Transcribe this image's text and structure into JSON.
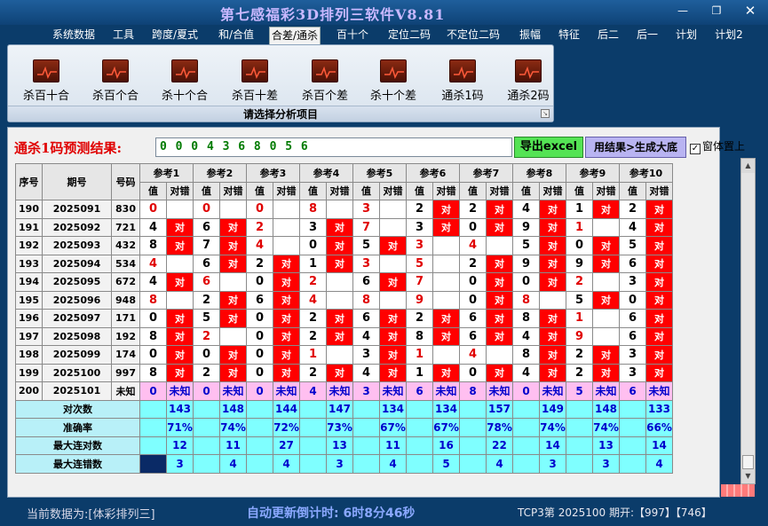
{
  "app": {
    "title": "第七感福彩3D排列三软件V8.81"
  },
  "menu": [
    "系统数据",
    "工具",
    "跨度/夏式",
    "和/合值",
    "合差/通杀",
    "百十个",
    "定位二码",
    "不定位二码",
    "振幅",
    "特征",
    "后二",
    "后一",
    "计划",
    "计划2"
  ],
  "menu_active": "合差/通杀",
  "ribbon": {
    "buttons": [
      "杀百十合",
      "杀百个合",
      "杀十个合",
      "杀百十差",
      "杀百个差",
      "杀十个差",
      "通杀1码",
      "通杀2码"
    ],
    "caption": "请选择分析项目"
  },
  "prediction": {
    "label": "通杀1码预测结果:",
    "value": "0 0 0 4 3 6 8 0 5 6",
    "export_button": "导出excel",
    "generate_button": "用结果>生成大底",
    "pin_checkbox": "窗体置上",
    "pin_checked": true
  },
  "table": {
    "h_seq": "序号",
    "h_period": "期号",
    "h_number": "号码",
    "ref_headers": [
      "参考1",
      "参考2",
      "参考3",
      "参考4",
      "参考5",
      "参考6",
      "参考7",
      "参考8",
      "参考9",
      "参考10"
    ],
    "sub_value": "值",
    "sub_flag": "对错",
    "hit_text": "对",
    "rows": [
      {
        "seq": "190",
        "period": "2025091",
        "num": "830",
        "vals": [
          "0",
          "0",
          "0",
          "8",
          "3",
          "2",
          "2",
          "4",
          "1",
          "2"
        ],
        "hits": [
          0,
          0,
          0,
          0,
          0,
          1,
          1,
          1,
          1,
          1
        ]
      },
      {
        "seq": "191",
        "period": "2025092",
        "num": "721",
        "vals": [
          "4",
          "6",
          "2",
          "3",
          "7",
          "3",
          "0",
          "9",
          "1",
          "4"
        ],
        "hits": [
          1,
          1,
          0,
          1,
          0,
          1,
          1,
          1,
          0,
          1
        ]
      },
      {
        "seq": "192",
        "period": "2025093",
        "num": "432",
        "vals": [
          "8",
          "7",
          "4",
          "0",
          "5",
          "3",
          "4",
          "5",
          "0",
          "5"
        ],
        "hits": [
          1,
          1,
          0,
          1,
          1,
          0,
          0,
          1,
          1,
          1
        ]
      },
      {
        "seq": "193",
        "period": "2025094",
        "num": "534",
        "vals": [
          "4",
          "6",
          "2",
          "1",
          "3",
          "5",
          "2",
          "9",
          "9",
          "6"
        ],
        "hits": [
          0,
          1,
          1,
          1,
          0,
          0,
          1,
          1,
          1,
          1
        ]
      },
      {
        "seq": "194",
        "period": "2025095",
        "num": "672",
        "vals": [
          "4",
          "6",
          "0",
          "2",
          "6",
          "7",
          "0",
          "0",
          "2",
          "3"
        ],
        "hits": [
          1,
          0,
          1,
          0,
          1,
          0,
          1,
          1,
          0,
          1
        ]
      },
      {
        "seq": "195",
        "period": "2025096",
        "num": "948",
        "vals": [
          "8",
          "2",
          "6",
          "4",
          "8",
          "9",
          "0",
          "8",
          "5",
          "0"
        ],
        "hits": [
          0,
          1,
          1,
          0,
          0,
          0,
          1,
          0,
          1,
          1
        ]
      },
      {
        "seq": "196",
        "period": "2025097",
        "num": "171",
        "vals": [
          "0",
          "5",
          "0",
          "2",
          "6",
          "2",
          "6",
          "8",
          "1",
          "6"
        ],
        "hits": [
          1,
          1,
          1,
          1,
          1,
          1,
          1,
          1,
          0,
          1
        ]
      },
      {
        "seq": "197",
        "period": "2025098",
        "num": "192",
        "vals": [
          "8",
          "2",
          "0",
          "2",
          "4",
          "8",
          "6",
          "4",
          "9",
          "6"
        ],
        "hits": [
          1,
          0,
          1,
          1,
          1,
          1,
          1,
          1,
          0,
          1
        ]
      },
      {
        "seq": "198",
        "period": "2025099",
        "num": "174",
        "vals": [
          "0",
          "0",
          "0",
          "1",
          "3",
          "1",
          "4",
          "8",
          "2",
          "3"
        ],
        "hits": [
          1,
          1,
          1,
          0,
          1,
          0,
          0,
          1,
          1,
          1
        ]
      },
      {
        "seq": "199",
        "period": "2025100",
        "num": "997",
        "vals": [
          "8",
          "2",
          "0",
          "2",
          "4",
          "1",
          "0",
          "4",
          "2",
          "3"
        ],
        "hits": [
          1,
          1,
          1,
          1,
          1,
          1,
          1,
          1,
          1,
          1
        ]
      }
    ],
    "last_row": {
      "seq": "200",
      "period": "2025101",
      "num": "未知",
      "vals": [
        "0",
        "0",
        "0",
        "4",
        "3",
        "6",
        "8",
        "0",
        "5",
        "6"
      ],
      "unknown": "未知"
    },
    "summary": [
      {
        "label": "对次数",
        "values": [
          "143",
          "148",
          "144",
          "147",
          "134",
          "134",
          "157",
          "149",
          "148",
          "133"
        ]
      },
      {
        "label": "准确率",
        "values": [
          "71%",
          "74%",
          "72%",
          "73%",
          "67%",
          "67%",
          "78%",
          "74%",
          "74%",
          "66%"
        ]
      },
      {
        "label": "最大连对数",
        "values": [
          "12",
          "11",
          "27",
          "13",
          "11",
          "16",
          "22",
          "14",
          "13",
          "14"
        ]
      },
      {
        "label": "最大连错数",
        "values": [
          "3",
          "4",
          "4",
          "3",
          "4",
          "5",
          "4",
          "3",
          "3",
          "4"
        ]
      }
    ]
  },
  "status": {
    "source": "当前数据为:[体彩排列三]",
    "countdown": "自动更新倒计时: 6时8分46秒",
    "draw": "TCP3第 2025100 期开:【997】【746】"
  },
  "colors": {
    "hit": "#ff0000",
    "summary": "#7fffff",
    "unknown": "#ffbff0",
    "title": "#c8b8ff"
  }
}
